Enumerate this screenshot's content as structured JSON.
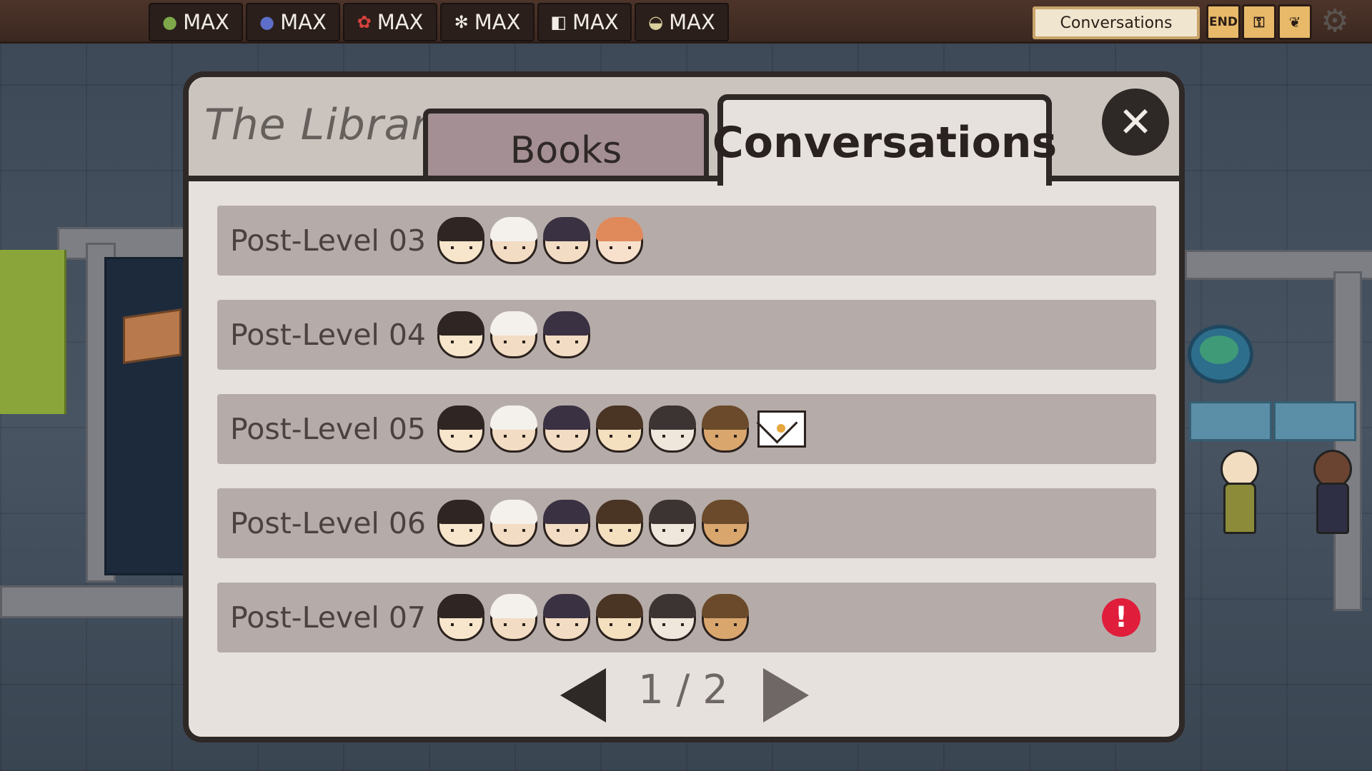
{
  "resources": [
    {
      "icon_name": "leaf-icon",
      "glyph": "●",
      "color": "#7ea84a",
      "label": "MAX"
    },
    {
      "icon_name": "blue-orb-icon",
      "glyph": "●",
      "color": "#5d6fc9",
      "label": "MAX"
    },
    {
      "icon_name": "berry-icon",
      "glyph": "✿",
      "color": "#d8413c",
      "label": "MAX"
    },
    {
      "icon_name": "flower-icon",
      "glyph": "✻",
      "color": "#f1ece6",
      "label": "MAX"
    },
    {
      "icon_name": "cube-icon",
      "glyph": "◧",
      "color": "#f1ece6",
      "label": "MAX"
    },
    {
      "icon_name": "bowl-icon",
      "glyph": "◒",
      "color": "#d9cf9c",
      "label": "MAX"
    }
  ],
  "top_right": {
    "current_screen": "Conversations",
    "end_label": "END"
  },
  "library": {
    "title": "The Library",
    "tabs": {
      "books": "Books",
      "conversations": "Conversations"
    },
    "close_glyph": "✕",
    "rows": [
      {
        "label": "Post-Level 03",
        "faces": [
          "lead",
          "white-hair",
          "dark-bun",
          "ginger"
        ],
        "letter": false,
        "alert": false
      },
      {
        "label": "Post-Level 04",
        "faces": [
          "lead",
          "white-hair",
          "dark-bun"
        ],
        "letter": false,
        "alert": false
      },
      {
        "label": "Post-Level 05",
        "faces": [
          "lead",
          "white-hair",
          "dark-bun",
          "brown-hair",
          "antlers",
          "crowned"
        ],
        "letter": true,
        "alert": false
      },
      {
        "label": "Post-Level 06",
        "faces": [
          "lead",
          "white-hair",
          "dark-bun",
          "brown-hair",
          "antlers",
          "crowned"
        ],
        "letter": false,
        "alert": false
      },
      {
        "label": "Post-Level 07",
        "faces": [
          "lead",
          "white-hair",
          "dark-bun",
          "brown-hair",
          "antlers",
          "crowned"
        ],
        "letter": false,
        "alert": true
      }
    ],
    "page": "1 / 2",
    "alert_glyph": "!"
  },
  "face_styles": {
    "lead": {
      "hair": "#2f2522",
      "skin": "#f7e6cc"
    },
    "white-hair": {
      "hair": "#f4f1ec",
      "skin": "#f2dcc3"
    },
    "dark-bun": {
      "hair": "#3a3142",
      "skin": "#f2dcc3"
    },
    "ginger": {
      "hair": "#e08a5c",
      "skin": "#f7e0cc"
    },
    "brown-hair": {
      "hair": "#4a3424",
      "skin": "#f4dfbf"
    },
    "antlers": {
      "hair": "#3b3432",
      "skin": "#efe6dc"
    },
    "crowned": {
      "hair": "#6a4a2a",
      "skin": "#d9a66e"
    }
  }
}
